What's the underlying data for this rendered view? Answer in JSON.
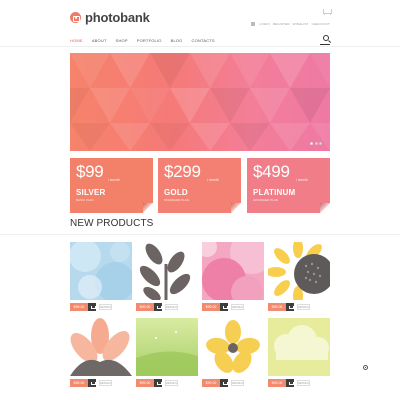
{
  "header": {
    "logo_text": "photobank",
    "top_links": [
      "Login",
      "Register",
      "Wishlist",
      "Checkout"
    ],
    "nav": [
      {
        "label": "HOME",
        "active": true
      },
      {
        "label": "ABOUT",
        "active": false
      },
      {
        "label": "SHOP",
        "active": false
      },
      {
        "label": "PORTFOLIO",
        "active": false
      },
      {
        "label": "BLOG",
        "active": false
      },
      {
        "label": "CONTACTS",
        "active": false
      }
    ],
    "icons": {
      "cart": "cart-icon",
      "search": "search-icon",
      "account": "user-icon"
    }
  },
  "hero": {
    "slide_count": 3,
    "active_slide": 1
  },
  "pricing": [
    {
      "price": "$99",
      "period": "/ month",
      "plan": "SILVER",
      "subtitle": "BASIC PLAN",
      "color": "#f3816a"
    },
    {
      "price": "$299",
      "period": "/ month",
      "plan": "GOLD",
      "subtitle": "STANDARD PLAN",
      "color": "#f38072"
    },
    {
      "price": "$499",
      "period": "/ month",
      "plan": "PLATINUM",
      "subtitle": "ADVANCED PLAN",
      "color": "#f17d88"
    }
  ],
  "new_products": {
    "title": "NEW PRODUCTS",
    "items": [
      {
        "price": "$99.00",
        "details": "DETAILS"
      },
      {
        "price": "$99.00",
        "details": "DETAILS"
      },
      {
        "price": "$99.00",
        "details": "DETAILS"
      },
      {
        "price": "$99.00",
        "details": "DETAILS"
      },
      {
        "price": "$99.00",
        "details": "DETAILS"
      },
      {
        "price": "$99.00",
        "details": "DETAILS"
      },
      {
        "price": "$99.00",
        "details": "DETAILS"
      },
      {
        "price": "$99.00",
        "details": "DETAILS"
      }
    ]
  },
  "colors": {
    "accent": "#e95a4f",
    "price_tag": "#f28a6d",
    "cart_button": "#3d3d3d"
  }
}
